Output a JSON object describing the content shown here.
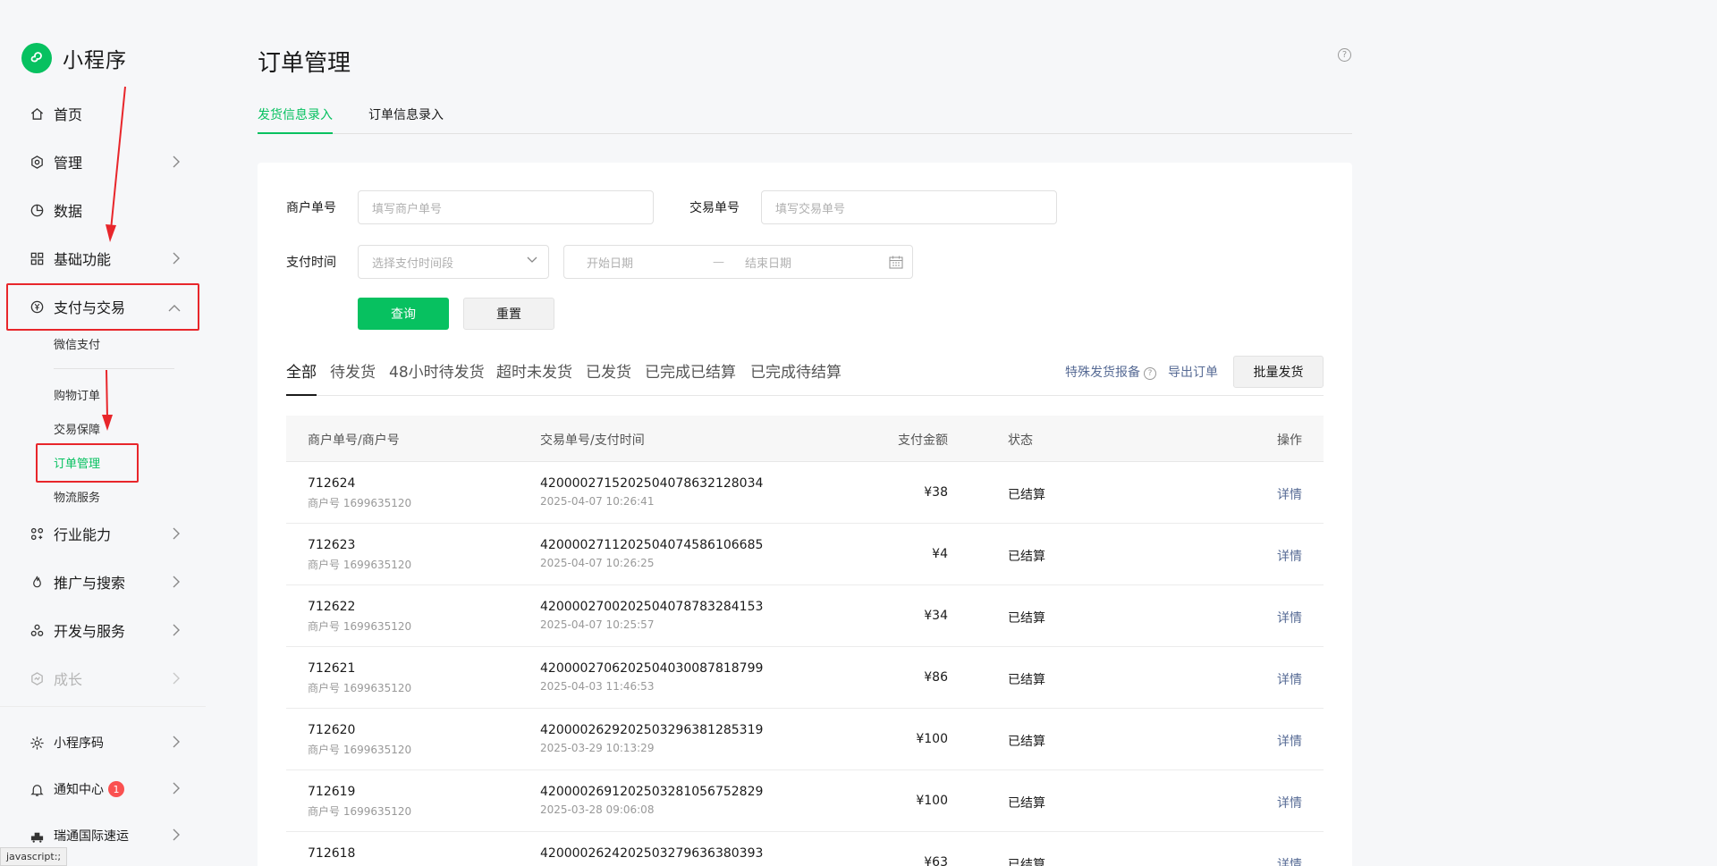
{
  "sidebar": {
    "brand": "小程序",
    "items": [
      {
        "label": "首页"
      },
      {
        "label": "管理"
      },
      {
        "label": "数据"
      },
      {
        "label": "基础功能"
      },
      {
        "label": "支付与交易"
      },
      {
        "label": "行业能力"
      },
      {
        "label": "推广与搜索"
      },
      {
        "label": "开发与服务"
      },
      {
        "label": "成长"
      }
    ],
    "sub_items": [
      {
        "label": "微信支付"
      },
      {
        "label": "购物订单"
      },
      {
        "label": "交易保障"
      },
      {
        "label": "订单管理"
      },
      {
        "label": "物流服务"
      }
    ],
    "bottom": [
      {
        "label": "小程序码"
      },
      {
        "label": "通知中心",
        "badge": "1"
      },
      {
        "label": "瑞通国际速运"
      }
    ]
  },
  "status_bar": "javascript:;",
  "page": {
    "title": "订单管理",
    "tabs": [
      "发货信息录入",
      "订单信息录入"
    ]
  },
  "filters": {
    "merchant_no_label": "商户单号",
    "merchant_no_placeholder": "填写商户单号",
    "trade_no_label": "交易单号",
    "trade_no_placeholder": "填写交易单号",
    "pay_time_label": "支付时间",
    "pay_time_placeholder": "选择支付时间段",
    "start_date": "开始日期",
    "date_sep": "—",
    "end_date": "结束日期",
    "query": "查询",
    "reset": "重置"
  },
  "status_tabs": [
    "全部",
    "待发货",
    "48小时待发货",
    "超时未发货",
    "已发货",
    "已完成已结算",
    "已完成待结算"
  ],
  "actions": {
    "special": "特殊发货报备",
    "export": "导出订单",
    "batch": "批量发货"
  },
  "table": {
    "headers": [
      "商户单号/商户号",
      "交易单号/支付时间",
      "支付金额",
      "状态",
      "操作"
    ],
    "rows": [
      {
        "order": "712624",
        "merchant": "商户号 1699635120",
        "trade": "4200002715202504078632128034",
        "time": "2025-04-07 10:26:41",
        "amount": "¥38",
        "status": "已结算",
        "op": "详情"
      },
      {
        "order": "712623",
        "merchant": "商户号 1699635120",
        "trade": "4200002711202504074586106685",
        "time": "2025-04-07 10:26:25",
        "amount": "¥4",
        "status": "已结算",
        "op": "详情"
      },
      {
        "order": "712622",
        "merchant": "商户号 1699635120",
        "trade": "4200002700202504078783284153",
        "time": "2025-04-07 10:25:57",
        "amount": "¥34",
        "status": "已结算",
        "op": "详情"
      },
      {
        "order": "712621",
        "merchant": "商户号 1699635120",
        "trade": "4200002706202504030087818799",
        "time": "2025-04-03 11:46:53",
        "amount": "¥86",
        "status": "已结算",
        "op": "详情"
      },
      {
        "order": "712620",
        "merchant": "商户号 1699635120",
        "trade": "4200002629202503296381285319",
        "time": "2025-03-29 10:13:29",
        "amount": "¥100",
        "status": "已结算",
        "op": "详情"
      },
      {
        "order": "712619",
        "merchant": "商户号 1699635120",
        "trade": "4200002691202503281056752829",
        "time": "2025-03-28 09:06:08",
        "amount": "¥100",
        "status": "已结算",
        "op": "详情"
      },
      {
        "order": "712618",
        "merchant": "",
        "trade": "4200002624202503279636380393",
        "time": "",
        "amount": "¥63",
        "status": "已结算",
        "op": "详情"
      }
    ]
  },
  "colors": {
    "accent": "#07c160",
    "link": "#576b95",
    "annotation": "#e8262b",
    "badge": "#fa5151"
  }
}
